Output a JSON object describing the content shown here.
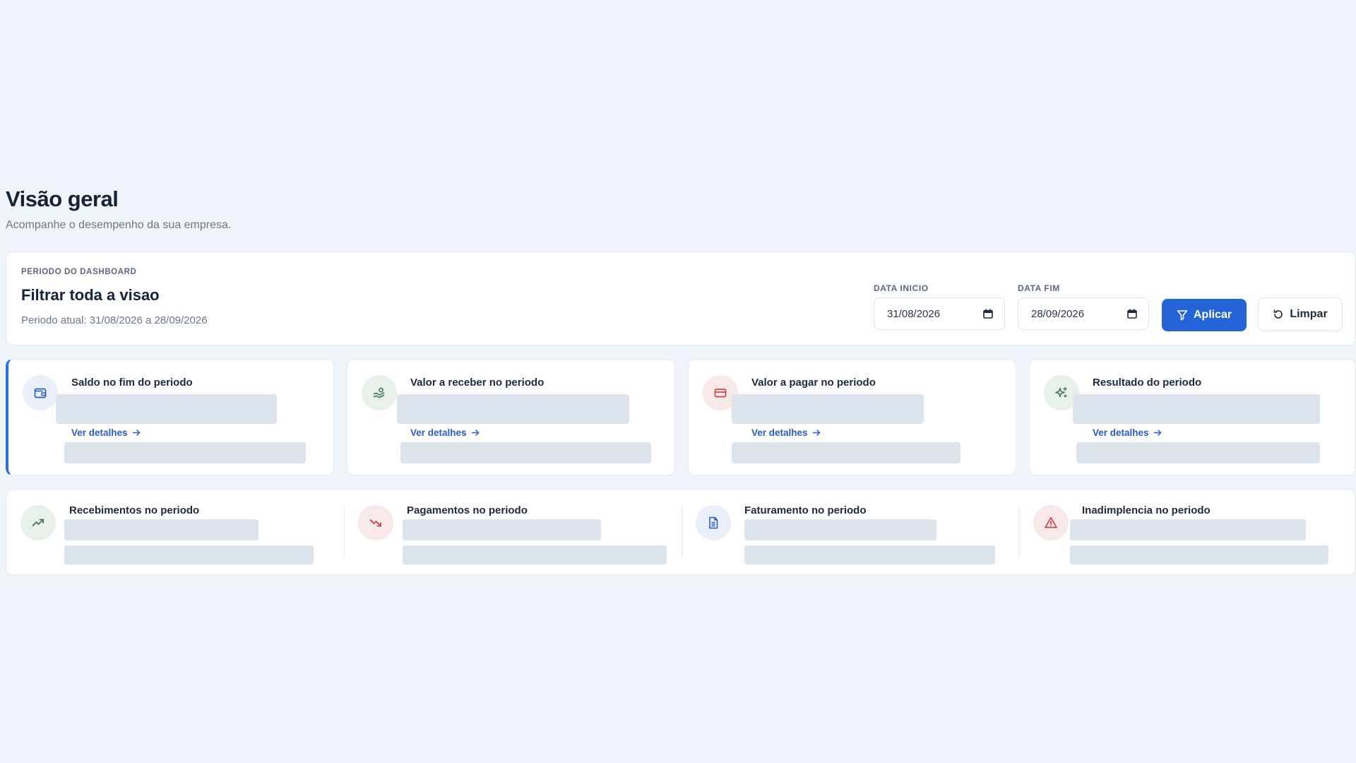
{
  "header": {
    "title": "Visão geral",
    "subtitle": "Acompanhe o desempenho da sua empresa."
  },
  "filter": {
    "eyebrow": "PERIODO DO DASHBOARD",
    "title": "Filtrar toda a visao",
    "current_period": "Periodo atual: 31/08/2026 a 28/09/2026",
    "start_label": "DATA INICIO",
    "start_value": "31/08/2026",
    "end_label": "DATA FIM",
    "end_value": "28/09/2026",
    "apply_label": "Aplicar",
    "clear_label": "Limpar"
  },
  "kpis": [
    {
      "title": "Saldo no fim do periodo",
      "link": "Ver detalhes",
      "icon": "wallet-icon"
    },
    {
      "title": "Valor a receber no periodo",
      "link": "Ver detalhes",
      "icon": "hand-coins-icon"
    },
    {
      "title": "Valor a pagar no periodo",
      "link": "Ver detalhes",
      "icon": "credit-card-icon"
    },
    {
      "title": "Resultado do periodo",
      "link": "Ver detalhes",
      "icon": "sparkles-icon"
    }
  ],
  "metrics": [
    {
      "title": "Recebimentos no periodo",
      "icon": "trending-up-icon"
    },
    {
      "title": "Pagamentos no periodo",
      "icon": "trending-down-icon"
    },
    {
      "title": "Faturamento no periodo",
      "icon": "file-text-icon"
    },
    {
      "title": "Inadimplencia no periodo",
      "icon": "alert-triangle-icon"
    }
  ],
  "colors": {
    "background": "#f0f4fb",
    "primary": "#2563d8",
    "link": "#2a5cc4",
    "skeleton": "#dbe3ed",
    "positive": "#3b7a52",
    "negative": "#c2454b"
  }
}
